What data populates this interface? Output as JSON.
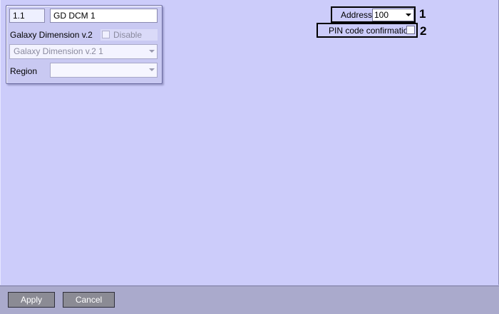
{
  "panel": {
    "id_value": "1.1",
    "name_value": "GD DCM 1",
    "type_label": "Galaxy Dimension v.2",
    "disable_label": "Disable",
    "device_value": "Galaxy Dimension v.2 1",
    "region_label": "Region",
    "region_value": ""
  },
  "settings": {
    "address_label": "Address:",
    "address_value": "100",
    "pin_label": "PIN code confirmation"
  },
  "markers": {
    "one": "1",
    "two": "2"
  },
  "footer": {
    "apply_label": "Apply",
    "cancel_label": "Cancel"
  },
  "colors": {
    "background": "#ccccfa",
    "footer": "#aaaacc",
    "button": "#8b8b94"
  },
  "icons": {
    "combo_arrow": "chevron-down-icon"
  }
}
